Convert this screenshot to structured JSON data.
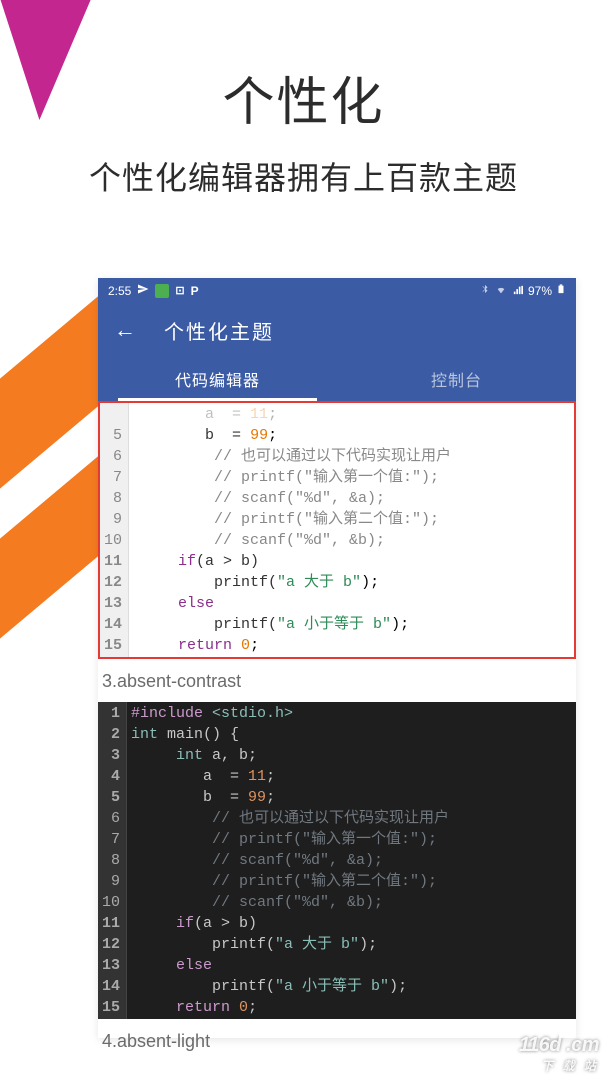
{
  "header": {
    "title": "个性化",
    "subtitle": "个性化编辑器拥有上百款主题"
  },
  "statusbar": {
    "time": "2:55",
    "battery": "97%"
  },
  "appbar": {
    "back_icon": "←",
    "title": "个性化主题"
  },
  "tabs": {
    "tab1": "代码编辑器",
    "tab2": "控制台"
  },
  "theme_labels": {
    "t3": "3.absent-contrast",
    "t4": "4.absent-light"
  },
  "light_code": {
    "line_numbers": [
      "5",
      "6",
      "7",
      "8",
      "9",
      "10",
      "11",
      "12",
      "13",
      "14",
      "15"
    ],
    "bold_lines": [
      "11",
      "12",
      "13",
      "14",
      "15"
    ],
    "l4_pre": "        a  ",
    "l4_op": "=",
    "l4_num": " 11",
    "l5_pre": "        b  ",
    "l5_op": "=",
    "l5_num": " 99",
    "l5_semi": ";",
    "l6": "         // 也可以通过以下代码实现让用户",
    "l7": "         // printf(\"输入第一个值:\");",
    "l8": "         // scanf(\"%d\", &a);",
    "l9": "         // printf(\"输入第二个值:\");",
    "l10": "         // scanf(\"%d\", &b);",
    "l11_if": "     if",
    "l11_cond": "(a > b)",
    "l12_print": "         printf(",
    "l12_str": "\"a 大于 b\"",
    "l12_end": ");",
    "l13_else": "     else",
    "l14_print": "         printf(",
    "l14_str": "\"a 小于等于 b\"",
    "l14_end": ");",
    "l15_ret": "     return",
    "l15_num": " 0",
    "l15_semi": ";"
  },
  "dark_code": {
    "line_numbers": [
      "1",
      "2",
      "3",
      "4",
      "5",
      "6",
      "7",
      "8",
      "9",
      "10",
      "11",
      "12",
      "13",
      "14",
      "15"
    ],
    "bold_lines": [
      "1",
      "2",
      "3",
      "4",
      "5",
      "11",
      "12",
      "13",
      "14",
      "15"
    ],
    "l1_macro": "#include",
    "l1_hdr": " <stdio.h>",
    "l2_type": "int",
    "l2_main": " main() {",
    "l3_type": "     int",
    "l3_vars": " a, b;",
    "l4_pre": "        a  = ",
    "l4_num": "11",
    "l4_semi": ";",
    "l5_pre": "        b  = ",
    "l5_num": "99",
    "l5_semi": ";",
    "l6": "         // 也可以通过以下代码实现让用户",
    "l7": "         // printf(\"输入第一个值:\");",
    "l8": "         // scanf(\"%d\", &a);",
    "l9": "         // printf(\"输入第二个值:\");",
    "l10": "         // scanf(\"%d\", &b);",
    "l11_if": "     if",
    "l11_cond": "(a > b)",
    "l12_print": "         printf(",
    "l12_str": "\"a 大于 b\"",
    "l12_end": ");",
    "l13_else": "     else",
    "l14_print": "         printf(",
    "l14_str": "\"a 小于等于 b\"",
    "l14_end": ");",
    "l15_ret": "     return",
    "l15_num": " 0",
    "l15_semi": ";"
  },
  "watermark": {
    "main": "116d",
    "dot": ".c",
    "suffix": "m",
    "sub": "下 载 站"
  }
}
